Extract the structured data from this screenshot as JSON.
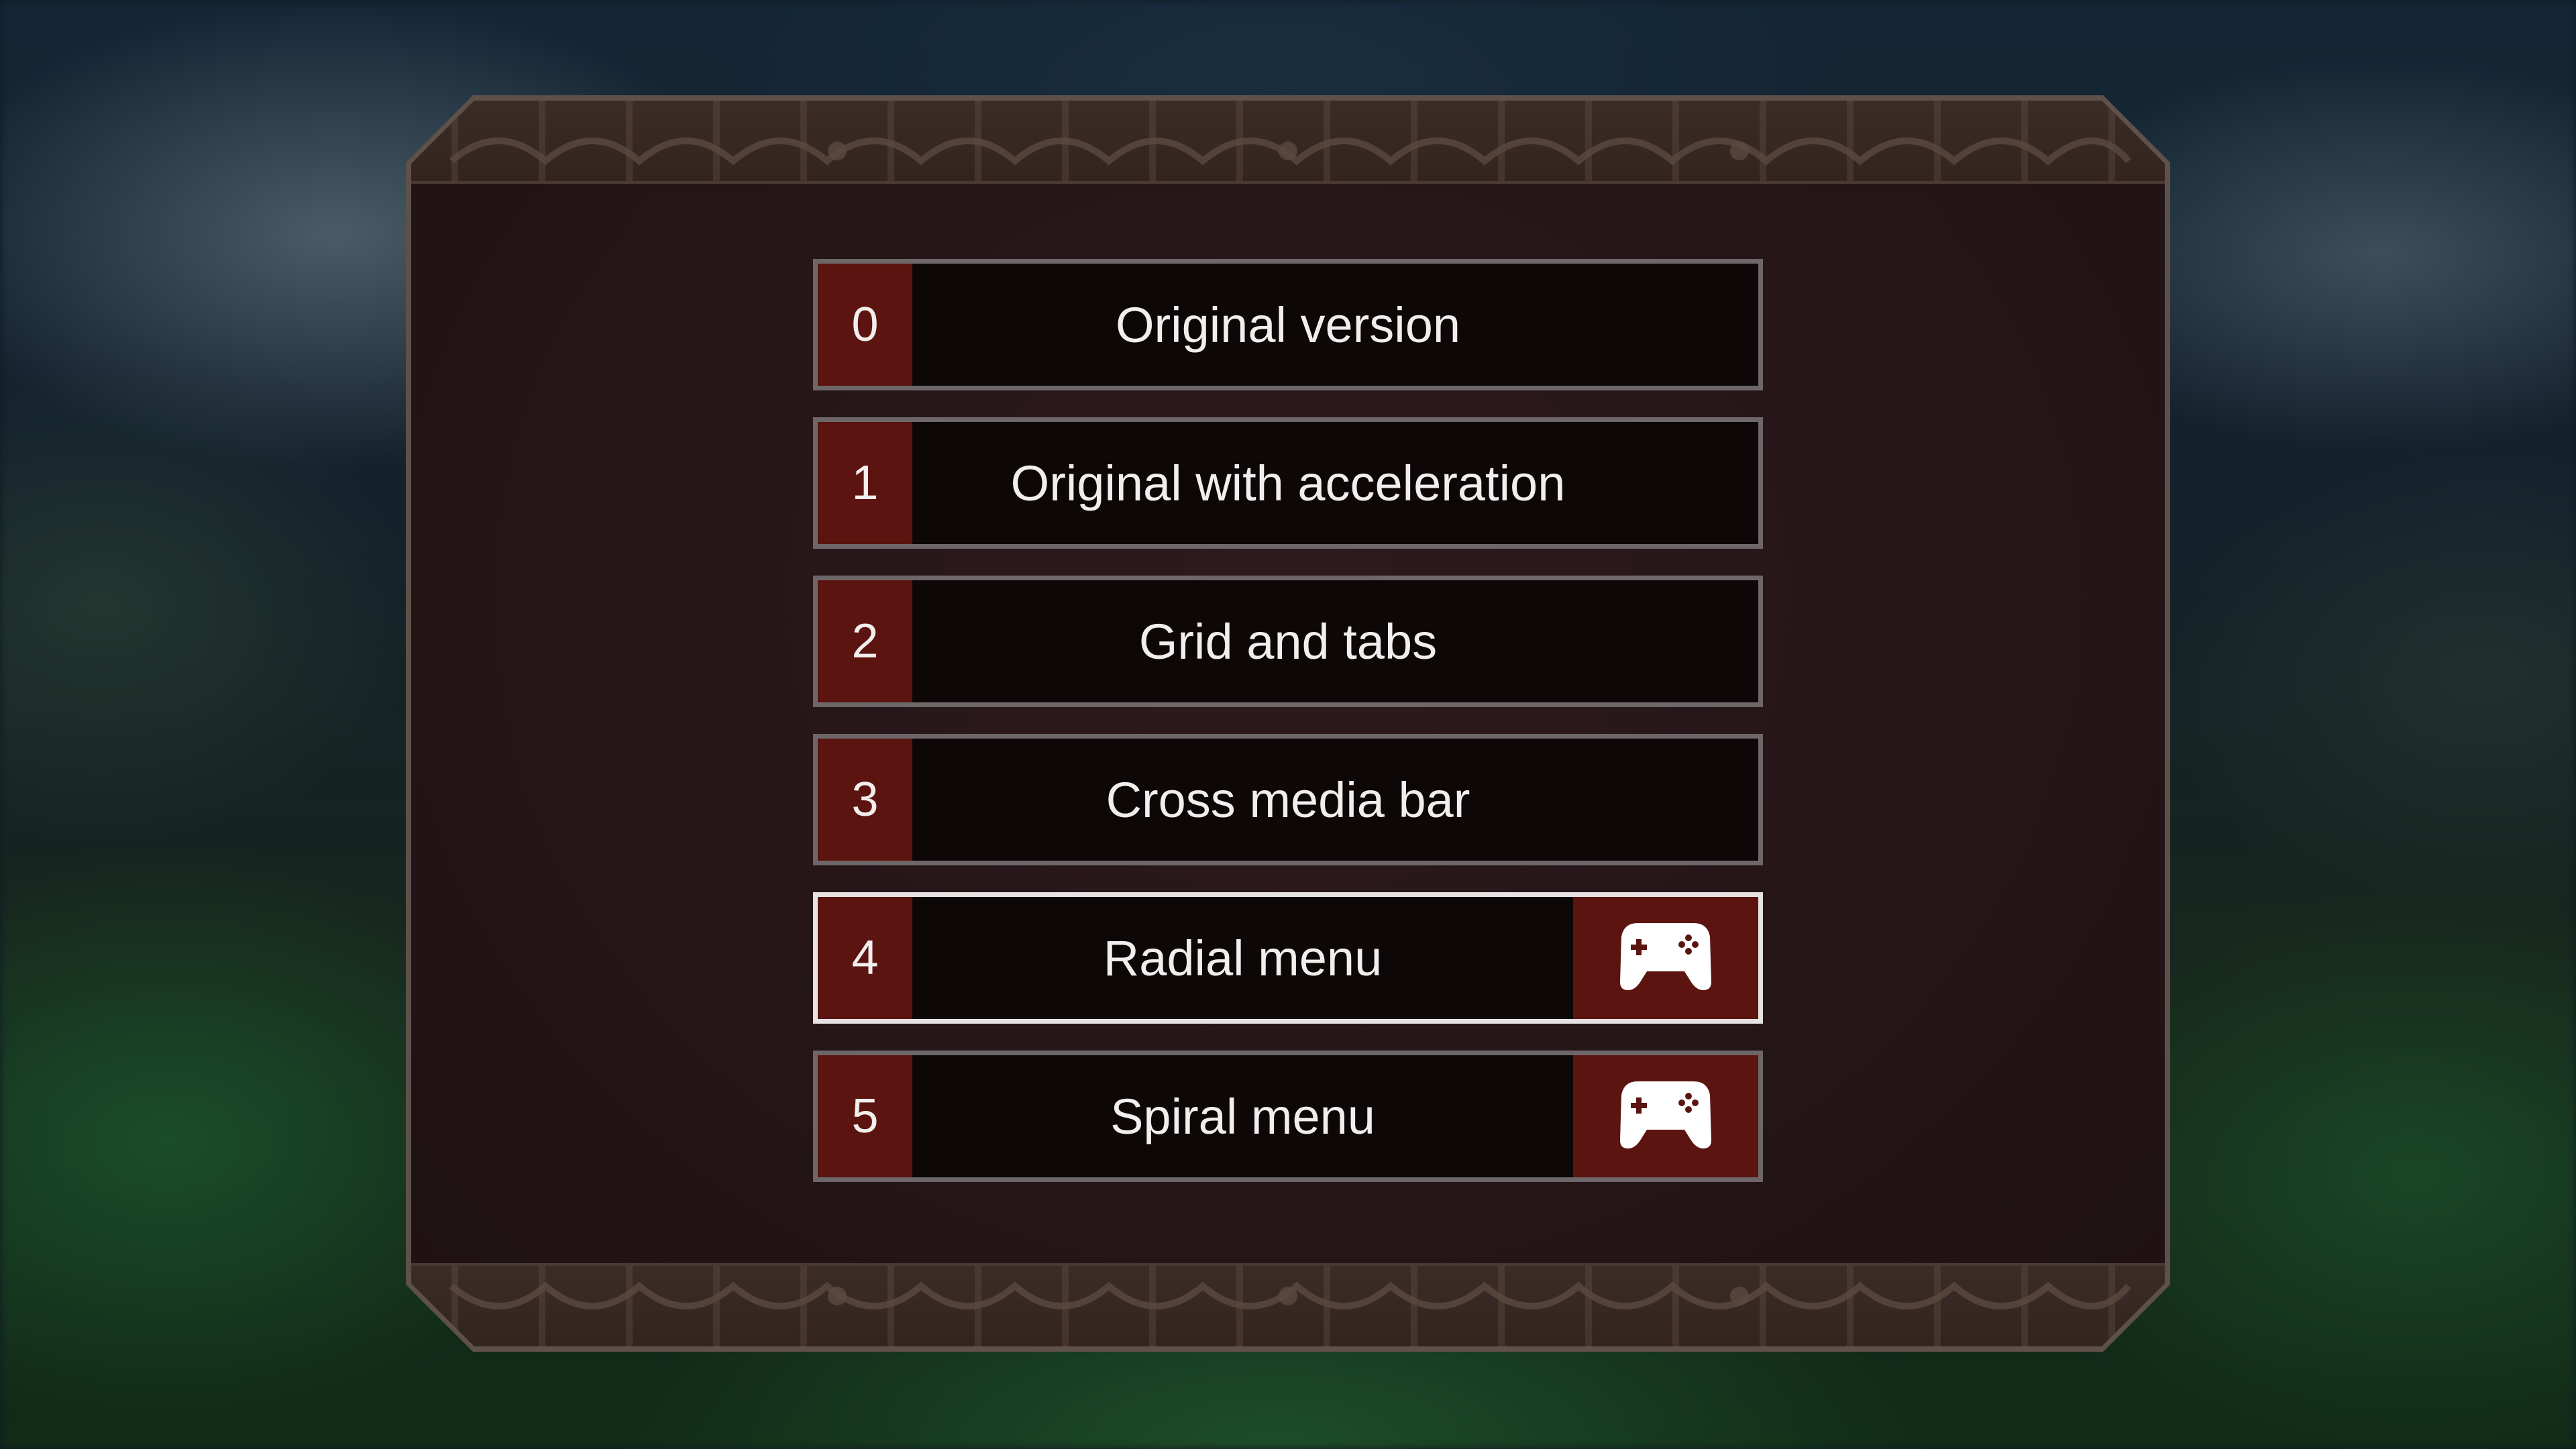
{
  "menu": {
    "items": [
      {
        "index": "0",
        "label": "Original version",
        "controller": false,
        "highlighted": false
      },
      {
        "index": "1",
        "label": "Original with acceleration",
        "controller": false,
        "highlighted": false
      },
      {
        "index": "2",
        "label": "Grid and tabs",
        "controller": false,
        "highlighted": false
      },
      {
        "index": "3",
        "label": "Cross media bar",
        "controller": false,
        "highlighted": false
      },
      {
        "index": "4",
        "label": "Radial menu",
        "controller": true,
        "highlighted": true
      },
      {
        "index": "5",
        "label": "Spiral menu",
        "controller": true,
        "highlighted": false
      }
    ],
    "controller_icon": "gamepad-icon"
  },
  "colors": {
    "index_bg": "#5b1410",
    "row_bg": "#0e0708",
    "row_border": "#6e6769",
    "highlight_border": "#e6e2e3",
    "text": "#f2eeee",
    "panel_bg": "#241517"
  }
}
